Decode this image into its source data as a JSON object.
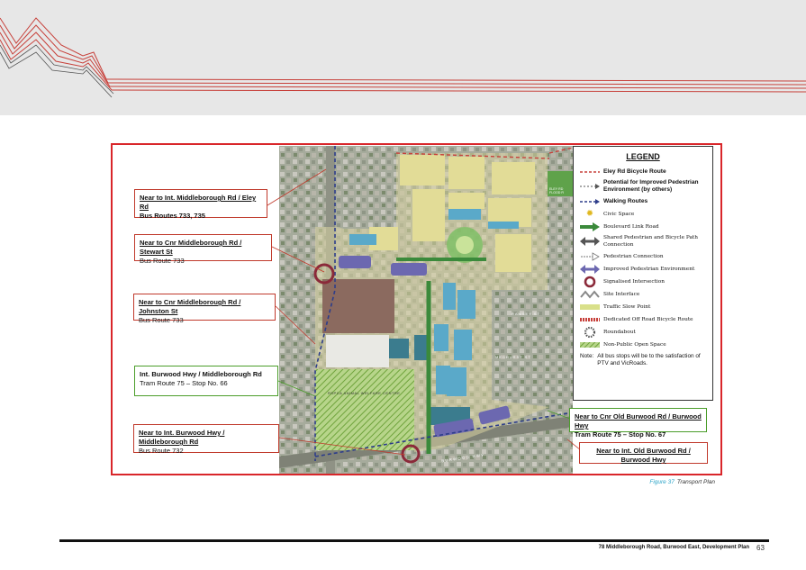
{
  "callouts": [
    {
      "id": "c1",
      "title": "Near to Int. Middleborough Rd / Eley Rd",
      "sub": "Bus Routes 733, 735"
    },
    {
      "id": "c2",
      "title": "Near to Cnr Middleborough Rd / Stewart St",
      "sub": "Bus Route 733"
    },
    {
      "id": "c3",
      "title": "Near to Cnr Middleborough Rd / Johnston St",
      "sub": "Bus Route 733"
    },
    {
      "id": "c4",
      "title": "Int. Burwood Hwy / Middleborough Rd",
      "sub": "Tram Route 75 – Stop No. 66"
    },
    {
      "id": "c5",
      "title": "Near to Int. Burwood Hwy / Middleborough Rd",
      "sub": "Bus Route 732"
    },
    {
      "id": "c6",
      "title": "Near to Cnr Old Burwood Rd / Burwood Hwy",
      "sub": "Tram Route 75 – Stop No. 67"
    },
    {
      "id": "c7",
      "title": "Near to Int. Old Burwood Rd / Burwood Hwy",
      "sub": ""
    }
  ],
  "legend": {
    "title": "LEGEND",
    "items": [
      {
        "label": "Eley Rd Bicycle Route",
        "icon": "dashed-red-line"
      },
      {
        "label": "Potential for Improved Pedestrian Environment (by others)",
        "icon": "dashed-arrow"
      },
      {
        "label": "Walking Routes",
        "icon": "dashed-navy-arrow"
      },
      {
        "label": "Civic Space",
        "icon": "yellow-star"
      },
      {
        "label": "Boulevard Link Road",
        "icon": "green-arrow"
      },
      {
        "label": "Shared Pedestrian and Bicycle Path Connection",
        "icon": "grey-double-arrow"
      },
      {
        "label": "Pedestrian Connection",
        "icon": "white-arrow"
      },
      {
        "label": "Improved Pedestrian Environment",
        "icon": "purple-double-arrow"
      },
      {
        "label": "Signalised Intersection",
        "icon": "maroon-ring"
      },
      {
        "label": "Site Interface",
        "icon": "grey-zigzag"
      },
      {
        "label": "Traffic Slow Point",
        "icon": "yellow-bar"
      },
      {
        "label": "Dedicated Off Road Bicycle Route",
        "icon": "red-dotted-bar"
      },
      {
        "label": "Roundabout",
        "icon": "dotted-ring"
      },
      {
        "label": "Non-Public Open Space",
        "icon": "green-hatch"
      }
    ],
    "note_label": "Note:",
    "note_text": "All bus stops will be to the satisfaction of PTV and VicRoads."
  },
  "map_labels": {
    "rspca": "RSPCA ANIMAL WELFARE CENTRE",
    "ramsey": "RAMSEY ST",
    "medhurst": "MEDHURST ST",
    "burwood_hwy": "BURWOOD HWY",
    "eley": "ELEY RD FLOOD R"
  },
  "caption": {
    "figure": "Figure 37",
    "title": "Transport Plan"
  },
  "footer": {
    "text": "78 Middleborough Road, Burwood East, Development Plan",
    "page": "63"
  }
}
